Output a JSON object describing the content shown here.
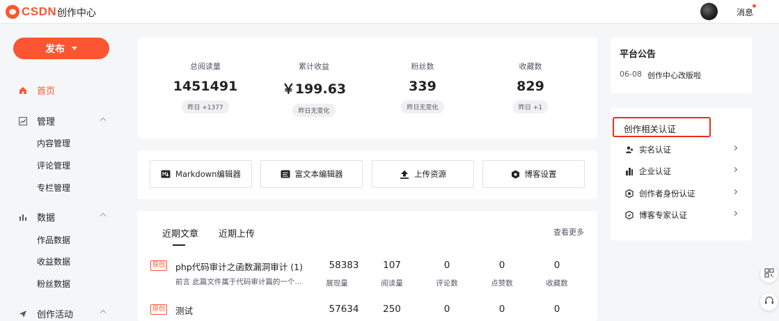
{
  "header": {
    "logo_text": "CSDN",
    "title": "创作中心",
    "messages_label": "消息"
  },
  "sidebar": {
    "publish_label": "发布",
    "home": "首页",
    "manage": {
      "label": "管理",
      "items": [
        "内容管理",
        "评论管理",
        "专栏管理"
      ]
    },
    "data": {
      "label": "数据",
      "items": [
        "作品数据",
        "收益数据",
        "粉丝数据"
      ]
    },
    "activity": {
      "label": "创作活动"
    }
  },
  "stats": [
    {
      "label": "总阅读量",
      "value": "1451491",
      "badge": "昨日 +1377"
    },
    {
      "label": "累计收益",
      "value": "￥199.63",
      "badge": "昨日无变化"
    },
    {
      "label": "粉丝数",
      "value": "339",
      "badge": "昨日无变化"
    },
    {
      "label": "收藏数",
      "value": "829",
      "badge": "昨日 +1"
    }
  ],
  "tools": [
    "Markdown编辑器",
    "富文本编辑器",
    "上传资源",
    "博客设置"
  ],
  "articles_panel": {
    "tabs": [
      "近期文章",
      "近期上传"
    ],
    "more": "查看更多",
    "columns": [
      "展现量",
      "阅读量",
      "评论数",
      "点赞数",
      "收藏数"
    ],
    "rows": [
      {
        "tag": "原创",
        "title": "php代码审计之函数漏洞审计 (1)",
        "desc": "前言 此篇文件属于代码审计篇的一个...",
        "values": [
          "58383",
          "107",
          "0",
          "0",
          "0"
        ]
      },
      {
        "tag": "原创",
        "title": "测试",
        "desc": "",
        "values": [
          "57634",
          "250",
          "0",
          "0",
          "0"
        ]
      }
    ]
  },
  "announcement": {
    "title": "平台公告",
    "date": "06-08",
    "text": "创作中心改版啦"
  },
  "certification": {
    "title": "创作相关认证",
    "items": [
      "实名认证",
      "企业认证",
      "创作者身份认证",
      "博客专家认证"
    ]
  },
  "colors": {
    "accent": "#fc5531",
    "highlight_border": "#e9301a"
  },
  "icons": [
    "home-icon",
    "chart-line-icon",
    "bar-chart-icon",
    "send-icon",
    "markdown-icon",
    "rich-text-icon",
    "upload-icon",
    "settings-hex-icon",
    "user-group-icon",
    "building-icon",
    "shield-icon",
    "expert-icon",
    "qrcode-icon",
    "headset-icon"
  ]
}
